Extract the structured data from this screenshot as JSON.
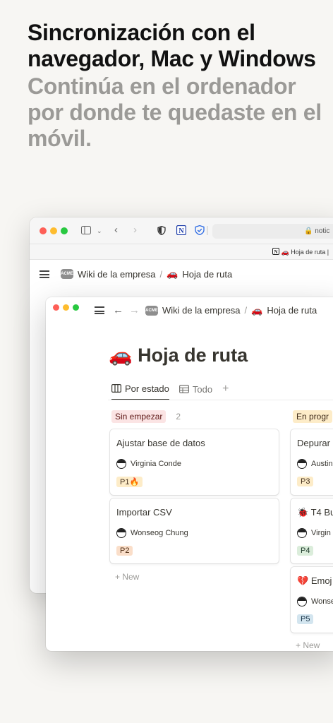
{
  "headline": {
    "title": "Sincronización con el navegador, Mac y Windows",
    "subtitle": "Continúa en el ordenador por donde te quedaste en el móvil."
  },
  "browser": {
    "url": "notic",
    "tab_title": "Hoja de ruta |",
    "breadcrumb_wiki": "Wiki de la empresa",
    "breadcrumb_sep": "/",
    "breadcrumb_page": "Hoja de ruta",
    "page_emoji": "🚗",
    "wiki_icon_text": "ACME"
  },
  "app": {
    "breadcrumb_wiki": "Wiki de la empresa",
    "breadcrumb_sep": "/",
    "breadcrumb_page": "Hoja de ruta",
    "page_emoji": "🚗",
    "page_title": "Hoja de ruta",
    "tabs": [
      {
        "label": "Por estado"
      },
      {
        "label": "Todo"
      }
    ],
    "columns": [
      {
        "name": "Sin empezar",
        "count": "2",
        "cards": [
          {
            "title": "Ajustar base de datos",
            "assignee": "Virginia Conde",
            "tag": "P1🔥"
          },
          {
            "title": "Importar CSV",
            "assignee": "Wonseog Chung",
            "tag": "P2"
          }
        ],
        "new_label": "New"
      },
      {
        "name": "En progr",
        "cards": [
          {
            "title": "Depurar c",
            "assignee": "Austin",
            "tag": "P3"
          },
          {
            "title": "T4 Bu",
            "title_emoji": "🐞",
            "assignee": "Virgin",
            "tag": "P4"
          },
          {
            "title": "Emoj",
            "title_emoji": "💔",
            "assignee": "Wonse",
            "tag": "P5"
          }
        ],
        "new_label": "New"
      }
    ]
  },
  "colors": {
    "background": "#f7f6f3",
    "subtitle": "#9b9a97",
    "pill_red": "#fbe4e4",
    "pill_yellow": "#fdecc8",
    "tag_p1": "#fdecc8",
    "tag_p2": "#fadec9",
    "tag_p3": "#fdecc8",
    "tag_p4": "#dbeddb",
    "tag_p5": "#d3e5ef"
  }
}
